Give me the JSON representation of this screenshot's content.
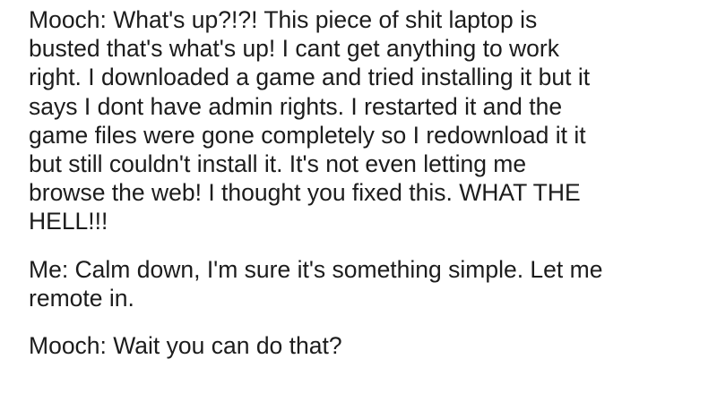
{
  "paragraphs": [
    {
      "lines": [
        "Mooch: What's up?!?! This piece of shit laptop is",
        "busted that's what's up! I cant get anything to work",
        "right. I downloaded a game and tried installing it but it",
        "says I dont have admin rights. I restarted it and the",
        "game files were gone completely so I redownload it it",
        "but still couldn't install it. It's not even letting me",
        "browse the web! I thought you fixed this. WHAT THE",
        "HELL!!!"
      ]
    },
    {
      "lines": [
        "Me: Calm down, I'm sure it's something simple. Let me",
        "remote in."
      ]
    },
    {
      "lines": [
        "Mooch: Wait you can do that?"
      ]
    }
  ]
}
